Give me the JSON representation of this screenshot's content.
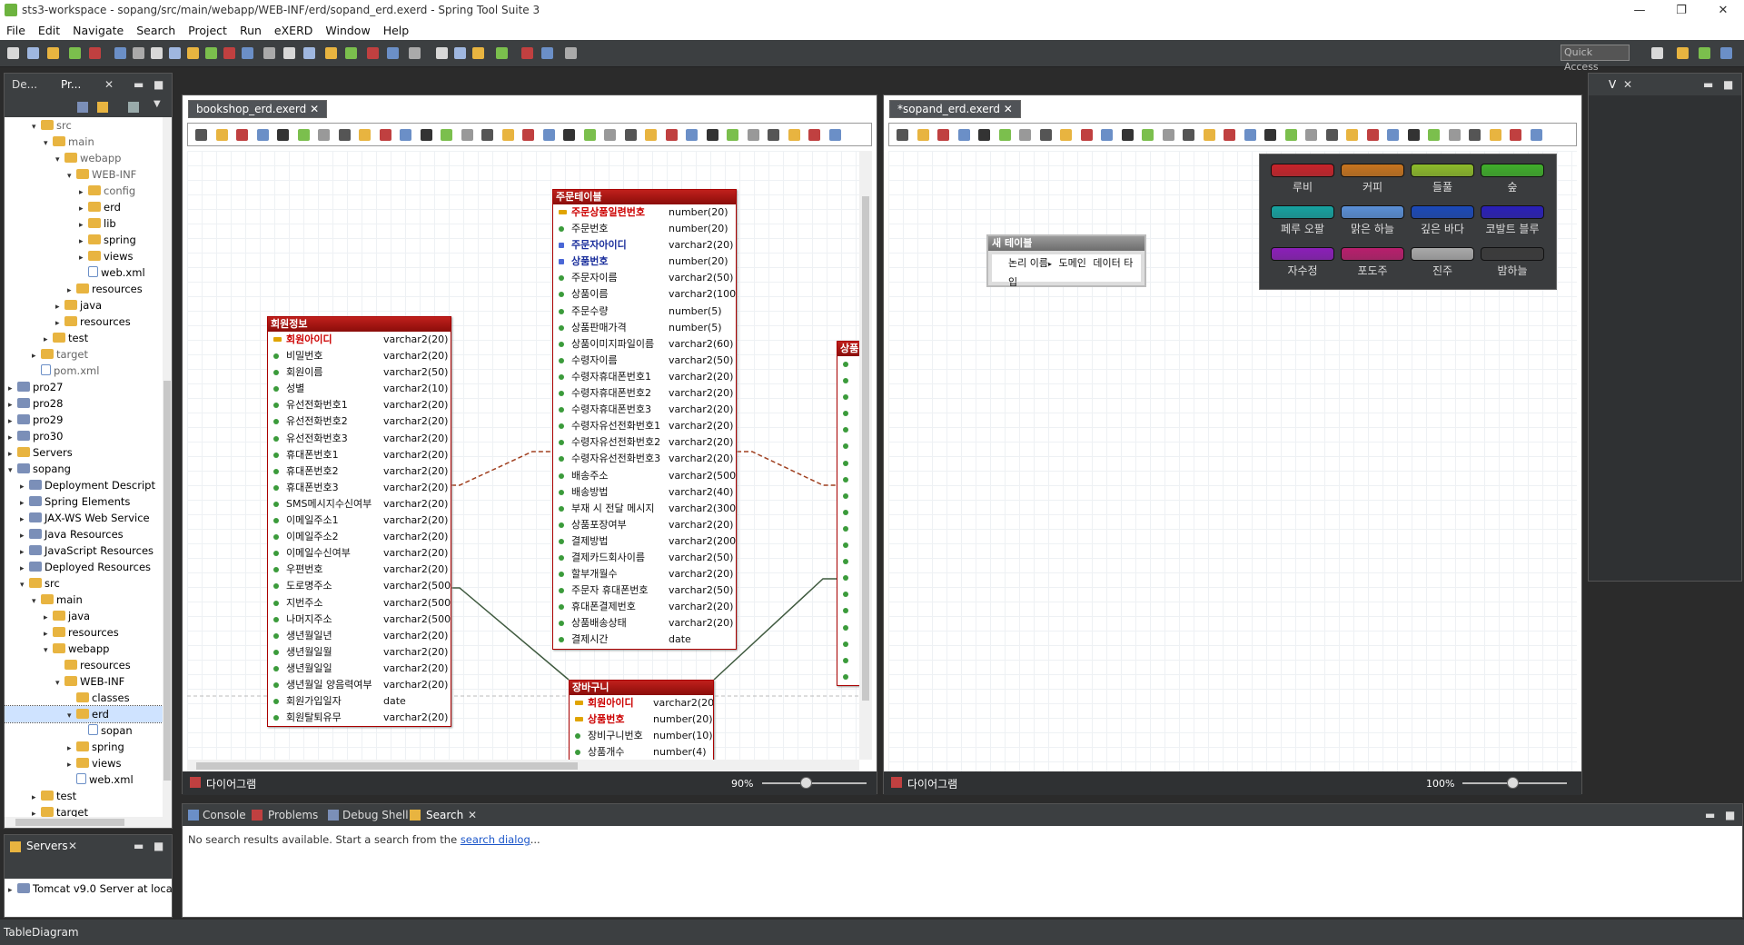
{
  "window": {
    "title": "sts3-workspace - sopang/src/main/webapp/WEB-INF/erd/sopand_erd.exerd - Spring Tool Suite 3"
  },
  "menu": [
    "File",
    "Edit",
    "Navigate",
    "Search",
    "Project",
    "Run",
    "eXERD",
    "Window",
    "Help"
  ],
  "toolbar": {
    "quick_access": "Quick Access"
  },
  "explorer": {
    "tabs": [
      "De...",
      "Pr..."
    ],
    "tree": [
      {
        "label": "src",
        "indent": 2,
        "icon": "folder",
        "tw": "▾",
        "dim": true
      },
      {
        "label": "main",
        "indent": 3,
        "icon": "folder",
        "tw": "▾",
        "dim": true
      },
      {
        "label": "webapp",
        "indent": 4,
        "icon": "folder",
        "tw": "▾",
        "dim": true
      },
      {
        "label": "WEB-INF",
        "indent": 5,
        "icon": "folder",
        "tw": "▾",
        "dim": true
      },
      {
        "label": "config",
        "indent": 6,
        "icon": "folder",
        "tw": "▸",
        "dim": true
      },
      {
        "label": "erd",
        "indent": 6,
        "icon": "folder",
        "tw": "▸"
      },
      {
        "label": "lib",
        "indent": 6,
        "icon": "folder",
        "tw": "▸"
      },
      {
        "label": "spring",
        "indent": 6,
        "icon": "folder",
        "tw": "▸"
      },
      {
        "label": "views",
        "indent": 6,
        "icon": "folder",
        "tw": "▸"
      },
      {
        "label": "web.xml",
        "indent": 6,
        "icon": "file",
        "tw": ""
      },
      {
        "label": "resources",
        "indent": 5,
        "icon": "folder",
        "tw": "▸"
      },
      {
        "label": "java",
        "indent": 4,
        "icon": "folder",
        "tw": "▸"
      },
      {
        "label": "resources",
        "indent": 4,
        "icon": "folder",
        "tw": "▸"
      },
      {
        "label": "test",
        "indent": 3,
        "icon": "folder",
        "tw": "▸"
      },
      {
        "label": "target",
        "indent": 2,
        "icon": "folder",
        "tw": "▸",
        "dim": true
      },
      {
        "label": "pom.xml",
        "indent": 2,
        "icon": "file",
        "tw": "",
        "dim": true
      },
      {
        "label": "pro27",
        "indent": 0,
        "icon": "project",
        "tw": "▸"
      },
      {
        "label": "pro28",
        "indent": 0,
        "icon": "project",
        "tw": "▸"
      },
      {
        "label": "pro29",
        "indent": 0,
        "icon": "project",
        "tw": "▸"
      },
      {
        "label": "pro30",
        "indent": 0,
        "icon": "project",
        "tw": "▸"
      },
      {
        "label": "Servers",
        "indent": 0,
        "icon": "folder",
        "tw": "▸"
      },
      {
        "label": "sopang",
        "indent": 0,
        "icon": "project",
        "tw": "▾"
      },
      {
        "label": "Deployment Descript",
        "indent": 1,
        "icon": "project",
        "tw": "▸"
      },
      {
        "label": "Spring Elements",
        "indent": 1,
        "icon": "project",
        "tw": "▸"
      },
      {
        "label": "JAX-WS Web Service",
        "indent": 1,
        "icon": "project",
        "tw": "▸"
      },
      {
        "label": "Java Resources",
        "indent": 1,
        "icon": "project",
        "tw": "▸"
      },
      {
        "label": "JavaScript Resources",
        "indent": 1,
        "icon": "project",
        "tw": "▸"
      },
      {
        "label": "Deployed Resources",
        "indent": 1,
        "icon": "project",
        "tw": "▸"
      },
      {
        "label": "src",
        "indent": 1,
        "icon": "folder",
        "tw": "▾"
      },
      {
        "label": "main",
        "indent": 2,
        "icon": "folder",
        "tw": "▾"
      },
      {
        "label": "java",
        "indent": 3,
        "icon": "folder",
        "tw": "▸"
      },
      {
        "label": "resources",
        "indent": 3,
        "icon": "folder",
        "tw": "▸"
      },
      {
        "label": "webapp",
        "indent": 3,
        "icon": "folder",
        "tw": "▾"
      },
      {
        "label": "resources",
        "indent": 4,
        "icon": "folder",
        "tw": ""
      },
      {
        "label": "WEB-INF",
        "indent": 4,
        "icon": "folder",
        "tw": "▾"
      },
      {
        "label": "classes",
        "indent": 5,
        "icon": "folder",
        "tw": ""
      },
      {
        "label": "erd",
        "indent": 5,
        "icon": "folder",
        "tw": "▾",
        "sel": true
      },
      {
        "label": "sopan",
        "indent": 6,
        "icon": "file",
        "tw": ""
      },
      {
        "label": "spring",
        "indent": 5,
        "icon": "folder",
        "tw": "▸"
      },
      {
        "label": "views",
        "indent": 5,
        "icon": "folder",
        "tw": "▸"
      },
      {
        "label": "web.xml",
        "indent": 5,
        "icon": "file",
        "tw": ""
      },
      {
        "label": "test",
        "indent": 2,
        "icon": "folder",
        "tw": "▸"
      },
      {
        "label": "target",
        "indent": 2,
        "icon": "folder",
        "tw": "▸"
      }
    ]
  },
  "servers_view": {
    "tab": "Servers",
    "item": "Tomcat v9.0 Server at loca"
  },
  "editor1": {
    "tab": "bookshop_erd.exerd",
    "footer_tab": "다이어그램",
    "zoom": "90%",
    "tables": [
      {
        "name": "회원정보",
        "cols": [
          [
            "회원아이디",
            "varchar2(20)",
            "pk"
          ],
          [
            "비밀번호",
            "varchar2(20)",
            ""
          ],
          [
            "회원이름",
            "varchar2(50)",
            ""
          ],
          [
            "성별",
            "varchar2(10)",
            ""
          ],
          [
            "유선전화번호1",
            "varchar2(20)",
            ""
          ],
          [
            "유선전화번호2",
            "varchar2(20)",
            ""
          ],
          [
            "유선전화번호3",
            "varchar2(20)",
            ""
          ],
          [
            "휴대폰번호1",
            "varchar2(20)",
            ""
          ],
          [
            "휴대폰번호2",
            "varchar2(20)",
            ""
          ],
          [
            "휴대폰번호3",
            "varchar2(20)",
            ""
          ],
          [
            "SMS메시지수신여부",
            "varchar2(20)",
            ""
          ],
          [
            "이메일주소1",
            "varchar2(20)",
            ""
          ],
          [
            "이메일주소2",
            "varchar2(20)",
            ""
          ],
          [
            "이메일수신여부",
            "varchar2(20)",
            ""
          ],
          [
            "우편번호",
            "varchar2(20)",
            ""
          ],
          [
            "도로명주소",
            "varchar2(500",
            ""
          ],
          [
            "지번주소",
            "varchar2(500",
            ""
          ],
          [
            "나머지주소",
            "varchar2(500",
            ""
          ],
          [
            "생년월일년",
            "varchar2(20)",
            ""
          ],
          [
            "생년월일월",
            "varchar2(20)",
            ""
          ],
          [
            "생년월일일",
            "varchar2(20)",
            ""
          ],
          [
            "생년월일 양음력여부",
            "varchar2(20)",
            ""
          ],
          [
            "회원가입일자",
            "date",
            ""
          ],
          [
            "회원탈퇴유무",
            "varchar2(20)",
            ""
          ]
        ]
      },
      {
        "name": "주문테이블",
        "cols": [
          [
            "주문상품일련번호",
            "number(20)",
            "pk"
          ],
          [
            "주문번호",
            "number(20)",
            ""
          ],
          [
            "주문자아이디",
            "varchar2(20)",
            "fk"
          ],
          [
            "상품번호",
            "number(20)",
            "fk"
          ],
          [
            "주문자이름",
            "varchar2(50)",
            ""
          ],
          [
            "상품이름",
            "varchar2(100",
            ""
          ],
          [
            "주문수량",
            "number(5)",
            ""
          ],
          [
            "상품판매가격",
            "number(5)",
            ""
          ],
          [
            "상품이미지파일이름",
            "varchar2(60)",
            ""
          ],
          [
            "수령자이름",
            "varchar2(50)",
            ""
          ],
          [
            "수령자휴대폰번호1",
            "varchar2(20)",
            ""
          ],
          [
            "수령자휴대폰번호2",
            "varchar2(20)",
            ""
          ],
          [
            "수령자휴대폰번호3",
            "varchar2(20)",
            ""
          ],
          [
            "수령자유선전화번호1",
            "varchar2(20)",
            ""
          ],
          [
            "수령자유선전화번호2",
            "varchar2(20)",
            ""
          ],
          [
            "수령자유선전화번호3",
            "varchar2(20)",
            ""
          ],
          [
            "배송주소",
            "varchar2(500",
            ""
          ],
          [
            "배송방법",
            "varchar2(40)",
            ""
          ],
          [
            "부재 시 전달 메시지",
            "varchar2(300",
            ""
          ],
          [
            "상품포장여부",
            "varchar2(20)",
            ""
          ],
          [
            "결제방법",
            "varchar2(200",
            ""
          ],
          [
            "결제카드회사이름",
            "varchar2(50)",
            ""
          ],
          [
            "할부개월수",
            "varchar2(20)",
            ""
          ],
          [
            "주문자 휴대폰번호",
            "varchar2(50)",
            ""
          ],
          [
            "휴대폰결제번호",
            "varchar2(20)",
            ""
          ],
          [
            "상품배송상태",
            "varchar2(20)",
            ""
          ],
          [
            "결제시간",
            "date",
            ""
          ]
        ]
      },
      {
        "name": "장바구니",
        "cols": [
          [
            "회원아이디",
            "varchar2(20)",
            "pk"
          ],
          [
            "상품번호",
            "number(20)",
            "pk"
          ],
          [
            "장비구니번호",
            "number(10)",
            ""
          ],
          [
            "상품개수",
            "number(4)",
            ""
          ]
        ]
      },
      {
        "name": "상품",
        "cols": []
      }
    ]
  },
  "editor2": {
    "tab": "*sopand_erd.exerd",
    "footer_tab": "다이어그램",
    "zoom": "100%",
    "new_table": {
      "name": "새 테이블",
      "header_cols": [
        "논리 이름",
        "도메인",
        "데이터 타입"
      ]
    },
    "palette": [
      {
        "label": "루비",
        "color": "#c8232a"
      },
      {
        "label": "커피",
        "color": "#c7741e"
      },
      {
        "label": "들풀",
        "color": "#8dbb2a"
      },
      {
        "label": "숲",
        "color": "#3fae2a"
      },
      {
        "label": "페루 오팔",
        "color": "#16a2a0"
      },
      {
        "label": "맑은 하늘",
        "color": "#5a8fd6"
      },
      {
        "label": "깊은 바다",
        "color": "#1b49b8"
      },
      {
        "label": "코발트 블루",
        "color": "#2a1fb8"
      },
      {
        "label": "자수정",
        "color": "#8b1fb8"
      },
      {
        "label": "포도주",
        "color": "#b81f6d"
      },
      {
        "label": "진주",
        "color": "#a9a9a9"
      },
      {
        "label": "밤하늘",
        "color": "#3b3b3b"
      }
    ]
  },
  "bottom_panel": {
    "tabs": [
      "Console",
      "Problems",
      "Debug Shell",
      "Search"
    ],
    "message": "No search results available. Start a search from the ",
    "link": "search dialog",
    "ellipsis": "..."
  },
  "right_panel": {
    "tab": "V"
  },
  "statusbar": {
    "text": "TableDiagram"
  }
}
